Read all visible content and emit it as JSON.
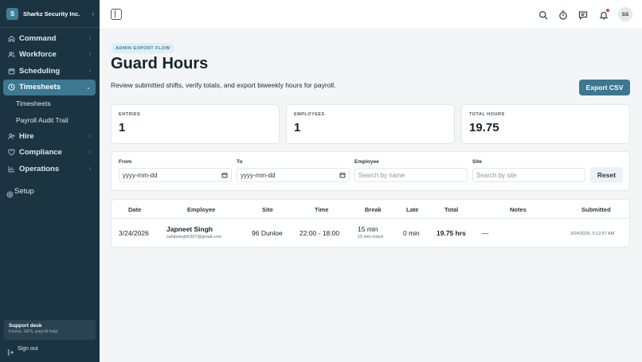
{
  "org": {
    "logo_letter": "S",
    "name": "Sharkz Security Inc."
  },
  "sidebar": {
    "items": [
      {
        "label": "Command",
        "icon": "home-icon"
      },
      {
        "label": "Workforce",
        "icon": "users-icon"
      },
      {
        "label": "Scheduling",
        "icon": "calendar-icon"
      },
      {
        "label": "Timesheets",
        "icon": "clock-icon",
        "active": true
      },
      {
        "label": "Hire",
        "icon": "user-plus-icon"
      },
      {
        "label": "Compliance",
        "icon": "heart-icon"
      },
      {
        "label": "Operations",
        "icon": "chart-icon"
      }
    ],
    "sub_items": [
      "Timesheets",
      "Payroll Audit Trail"
    ],
    "setup_label": "Setup",
    "support": {
      "title": "Support desk",
      "subtitle": "Forms, GPS, payroll help"
    },
    "signout_label": "Sign out"
  },
  "topbar": {
    "avatar_initials": "SS"
  },
  "page": {
    "eyebrow": "ADMIN EXPORT FLOW",
    "title": "Guard Hours",
    "subtitle": "Review submitted shifts, verify totals, and export biweekly hours for payroll.",
    "export_label": "Export CSV"
  },
  "stats": [
    {
      "label": "ENTRIES",
      "value": "1"
    },
    {
      "label": "EMPLOYEES",
      "value": "1"
    },
    {
      "label": "TOTAL HOURS",
      "value": "19.75"
    }
  ],
  "filters": {
    "from": {
      "label": "From",
      "placeholder": "yyyy-mm-dd"
    },
    "to": {
      "label": "To",
      "placeholder": "yyyy-mm-dd"
    },
    "employee": {
      "label": "Employee",
      "placeholder": "Search by name"
    },
    "site": {
      "label": "Site",
      "placeholder": "Search by site"
    },
    "reset_label": "Reset"
  },
  "table": {
    "headers": [
      "Date",
      "Employee",
      "Site",
      "Time",
      "Break",
      "Late",
      "Total",
      "Notes",
      "Submitted"
    ],
    "rows": [
      {
        "date": "3/24/2026",
        "employee_name": "Japneet Singh",
        "employee_email": "sahibsingh0307@gmail.com",
        "site": "96 Dunloe",
        "time": "22:00 - 18:00",
        "break": "15 min",
        "break_note": "15 min noted",
        "late": "0 min",
        "total": "19.75 hrs",
        "notes": "—",
        "submitted": "3/24/2026, 5:12:57 AM"
      }
    ]
  }
}
